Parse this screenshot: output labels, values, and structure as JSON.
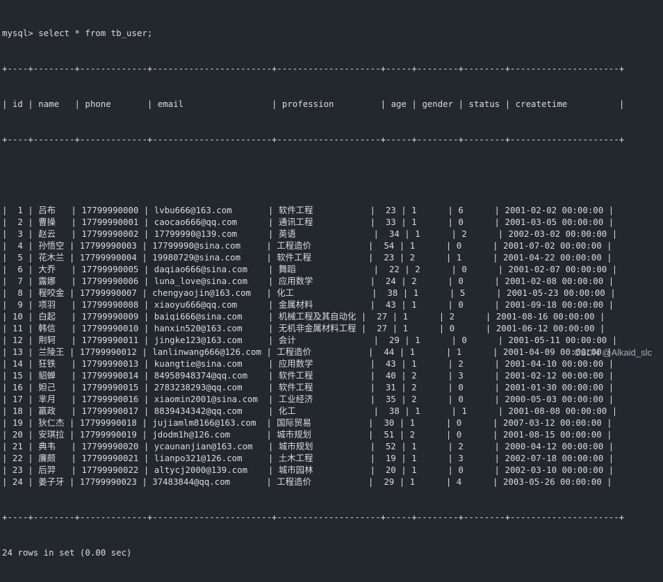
{
  "terminal": {
    "prompt": "mysql> ",
    "command": "select * from tb_user;",
    "columns": [
      "id",
      "name",
      "phone",
      "email",
      "profession",
      "age",
      "gender",
      "status",
      "createtime"
    ],
    "rows": [
      [
        "1",
        "吕布",
        "17799990000",
        "lvbu666@163.com",
        "软件工程",
        "23",
        "1",
        "6",
        "2001-02-02 00:00:00"
      ],
      [
        "2",
        "曹操",
        "17799990001",
        "caocao666@qq.com",
        "通讯工程",
        "33",
        "1",
        "0",
        "2001-03-05 00:00:00"
      ],
      [
        "3",
        "赵云",
        "17799990002",
        "17799990@139.com",
        "英语",
        "34",
        "1",
        "2",
        "2002-03-02 00:00:00"
      ],
      [
        "4",
        "孙悟空",
        "17799990003",
        "17799990@sina.com",
        "工程造价",
        "54",
        "1",
        "0",
        "2001-07-02 00:00:00"
      ],
      [
        "5",
        "花木兰",
        "17799990004",
        "19980729@sina.com",
        "软件工程",
        "23",
        "2",
        "1",
        "2001-04-22 00:00:00"
      ],
      [
        "6",
        "大乔",
        "17799990005",
        "daqiao666@sina.com",
        "舞蹈",
        "22",
        "2",
        "0",
        "2001-02-07 00:00:00"
      ],
      [
        "7",
        "露娜",
        "17799990006",
        "luna_love@sina.com",
        "应用数学",
        "24",
        "2",
        "0",
        "2001-02-08 00:00:00"
      ],
      [
        "8",
        "程咬金",
        "17799990007",
        "chengyaojin@163.com",
        "化工",
        "38",
        "1",
        "5",
        "2001-05-23 00:00:00"
      ],
      [
        "9",
        "项羽",
        "17799990008",
        "xiaoyu666@qq.com",
        "金属材料",
        "43",
        "1",
        "0",
        "2001-09-18 00:00:00"
      ],
      [
        "10",
        "白起",
        "17799990009",
        "baiqi666@sina.com",
        "机械工程及其自动化",
        "27",
        "1",
        "2",
        "2001-08-16 00:00:00"
      ],
      [
        "11",
        "韩信",
        "17799990010",
        "hanxin520@163.com",
        "无机非金属材料工程",
        "27",
        "1",
        "0",
        "2001-06-12 00:00:00"
      ],
      [
        "12",
        "荆轲",
        "17799990011",
        "jingke123@163.com",
        "会计",
        "29",
        "1",
        "0",
        "2001-05-11 00:00:00"
      ],
      [
        "13",
        "兰陵王",
        "17799990012",
        "lanlinwang666@126.com",
        "工程造价",
        "44",
        "1",
        "1",
        "2001-04-09 00:00:00"
      ],
      [
        "14",
        "狂铁",
        "17799990013",
        "kuangtie@sina.com",
        "应用数学",
        "43",
        "1",
        "2",
        "2001-04-10 00:00:00"
      ],
      [
        "15",
        "貂蝉",
        "17799990014",
        "84958948374@qq.com",
        "软件工程",
        "40",
        "2",
        "3",
        "2001-02-12 00:00:00"
      ],
      [
        "16",
        "妲己",
        "17799990015",
        "2783238293@qq.com",
        "软件工程",
        "31",
        "2",
        "0",
        "2001-01-30 00:00:00"
      ],
      [
        "17",
        "芈月",
        "17799990016",
        "xiaomin2001@sina.com",
        "工业经济",
        "35",
        "2",
        "0",
        "2000-05-03 00:00:00"
      ],
      [
        "18",
        "嬴政",
        "17799990017",
        "8839434342@qq.com",
        "化工",
        "38",
        "1",
        "1",
        "2001-08-08 00:00:00"
      ],
      [
        "19",
        "狄仁杰",
        "17799990018",
        "jujiamlm8166@163.com",
        "国际贸易",
        "30",
        "1",
        "0",
        "2007-03-12 00:00:00"
      ],
      [
        "20",
        "安琪拉",
        "17799990019",
        "jdodm1h@126.com",
        "城市规划",
        "51",
        "2",
        "0",
        "2001-08-15 00:00:00"
      ],
      [
        "21",
        "典韦",
        "17799990020",
        "ycaunanjian@163.com",
        "城市规划",
        "52",
        "1",
        "2",
        "2000-04-12 00:00:00"
      ],
      [
        "22",
        "廉颇",
        "17799990021",
        "lianpo321@126.com",
        "土木工程",
        "19",
        "1",
        "3",
        "2002-07-18 00:00:00"
      ],
      [
        "23",
        "后羿",
        "17799990022",
        "altycj2000@139.com",
        "城市园林",
        "20",
        "1",
        "0",
        "2002-03-10 00:00:00"
      ],
      [
        "24",
        "姜子牙",
        "17799990023",
        "37483844@qq.com",
        "工程造价",
        "29",
        "1",
        "4",
        "2003-05-26 00:00:00"
      ]
    ],
    "summary": "24 rows in set (0.00 sec)"
  },
  "watermark": "CSDN @Alkaid_slc"
}
